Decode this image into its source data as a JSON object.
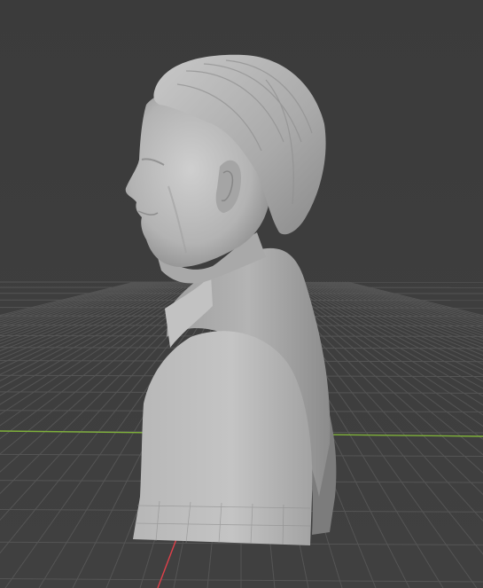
{
  "app": {
    "name": "",
    "view": "3D Viewport"
  },
  "viewport": {
    "background_color": "#3d3d3d",
    "grid_color": "#555555",
    "grid_strong_color": "#666666",
    "x_axis_color": "#e0404a",
    "y_axis_color": "#7fb13a",
    "object_color": "#bdbdbd",
    "object": {
      "type": "sculpted-bust",
      "description_icon": "bust-mesh-icon"
    }
  }
}
